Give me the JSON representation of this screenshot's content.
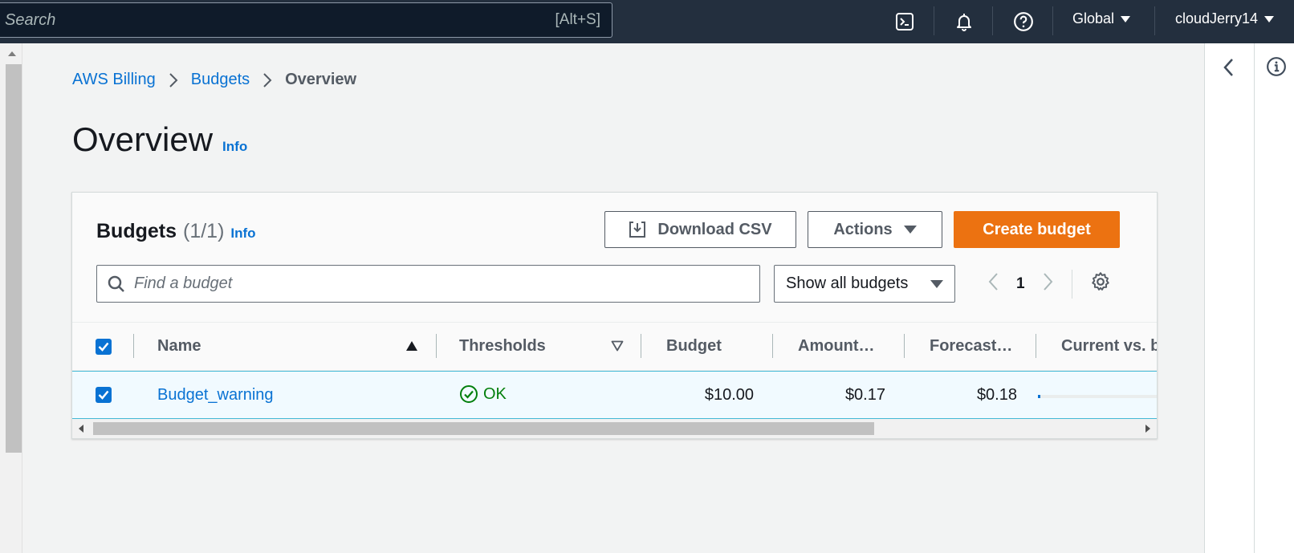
{
  "topbar": {
    "search_placeholder": "Search",
    "search_shortcut": "[Alt+S]",
    "region_label": "Global",
    "user_label": "cloudJerry14"
  },
  "breadcrumb": {
    "items": [
      "AWS Billing",
      "Budgets"
    ],
    "current": "Overview"
  },
  "page": {
    "title": "Overview",
    "info_label": "Info"
  },
  "budgets": {
    "title": "Budgets",
    "count": "(1/1)",
    "info_label": "Info",
    "download_label": "Download CSV",
    "actions_label": "Actions",
    "create_label": "Create budget",
    "find_placeholder": "Find a budget",
    "filter_value": "Show all budgets",
    "page_number": "1",
    "columns": [
      "Name",
      "Thresholds",
      "Budget",
      "Amount…",
      "Forecast…",
      "Current vs. b"
    ],
    "rows": [
      {
        "name": "Budget_warning",
        "threshold_status": "OK",
        "budget": "$10.00",
        "amount": "$0.17",
        "forecast": "$0.18",
        "current_vs_budget_fraction": 0.017
      }
    ]
  },
  "colors": {
    "topbar_bg": "#232f3e",
    "link": "#0972d3",
    "primary_button": "#ec7211",
    "status_ok": "#037f0c"
  }
}
